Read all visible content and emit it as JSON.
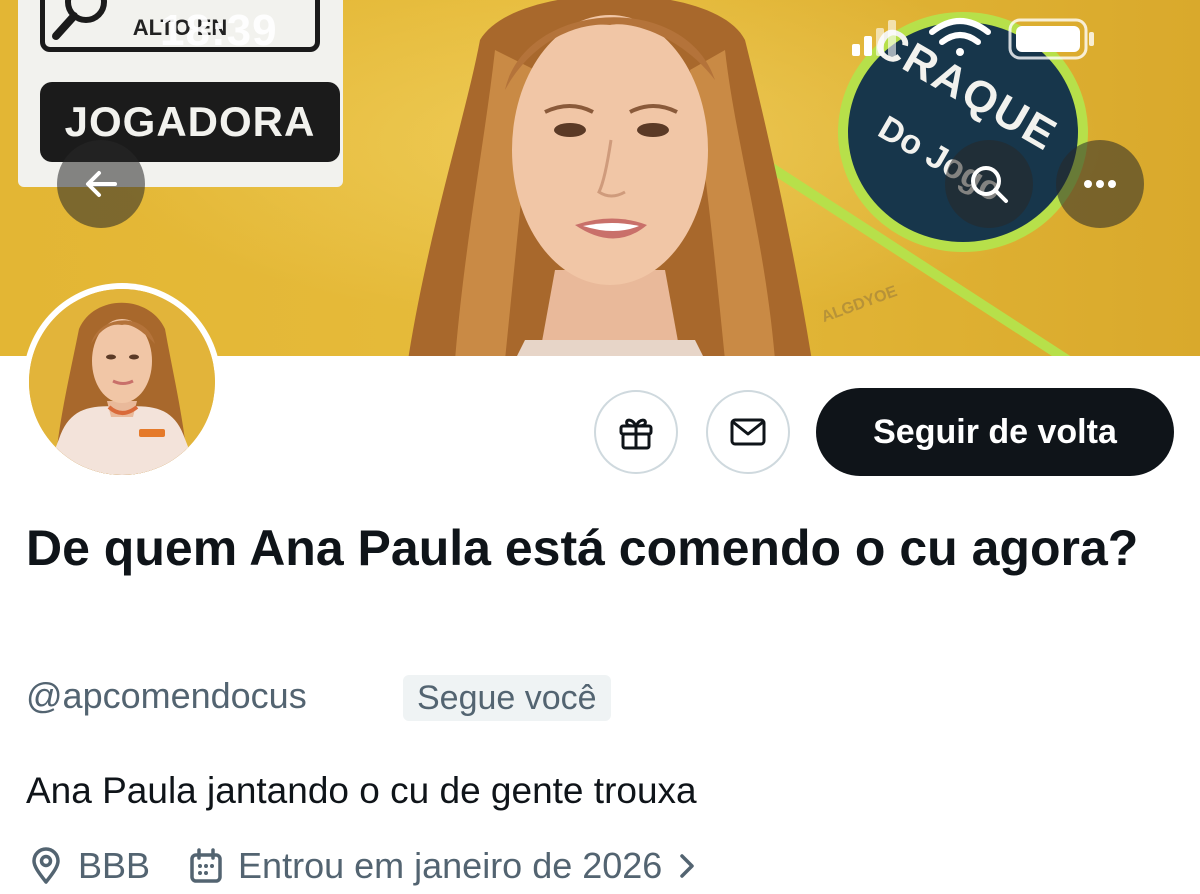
{
  "status_bar": {
    "time": "18:39"
  },
  "banner": {
    "sign_top_text": "ALTO EN",
    "sign_bottom_text": "JOGADORA",
    "badge_line1": "CRAQUE",
    "badge_line2": "Do Jogo",
    "watermark": "ALGDYOE",
    "background_color": "#e3b634",
    "badge_color": "#17364b",
    "accent_green": "#b7e04a"
  },
  "nav": {
    "back_icon": "arrow-left-icon",
    "search_icon": "search-icon",
    "more_icon": "more-horizontal-icon"
  },
  "actions": {
    "gift_icon": "gift-icon",
    "message_icon": "envelope-icon",
    "follow_label": "Seguir de volta"
  },
  "profile": {
    "display_name": "De quem Ana Paula está comendo o cu agora?",
    "handle": "@apcomendocus",
    "follows_you_label": "Segue você",
    "bio": "Ana Paula jantando o cu de gente trouxa",
    "location": "BBB",
    "joined": "Entrou em janeiro de 2026"
  },
  "colors": {
    "text_primary": "#0f1419",
    "text_secondary": "#536471",
    "button_dark": "#0f1419",
    "chip_bg": "#eff3f4"
  }
}
